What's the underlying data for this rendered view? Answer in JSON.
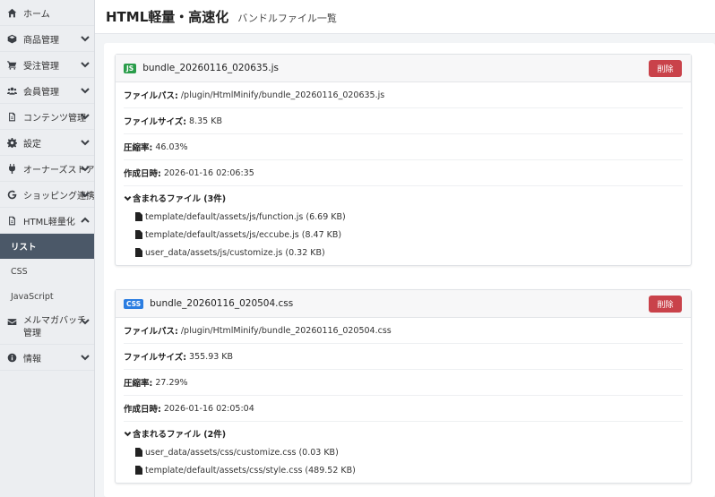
{
  "header": {
    "title": "HTML軽量・高速化",
    "subtitle": "バンドルファイル一覧"
  },
  "sidebar": {
    "items": [
      {
        "label": "ホーム",
        "icon": "home-icon"
      },
      {
        "label": "商品管理",
        "icon": "cube-icon"
      },
      {
        "label": "受注管理",
        "icon": "cart-icon"
      },
      {
        "label": "会員管理",
        "icon": "users-icon"
      },
      {
        "label": "コンテンツ管理",
        "icon": "file-icon"
      },
      {
        "label": "設定",
        "icon": "gear-icon"
      },
      {
        "label": "オーナーズストア",
        "icon": "plug-icon"
      },
      {
        "label": "ショッピング連携",
        "icon": "google-icon"
      },
      {
        "label": "HTML軽量化",
        "icon": "file-code-icon"
      },
      {
        "label": "メルマガバッチ管理",
        "icon": "envelope-icon"
      },
      {
        "label": "情報",
        "icon": "info-icon"
      }
    ],
    "html_submenu": [
      {
        "label": "リスト",
        "active": true
      },
      {
        "label": "CSS",
        "active": false
      },
      {
        "label": "JavaScript",
        "active": false
      }
    ]
  },
  "labels": {
    "path": "ファイルパス:",
    "size": "ファイルサイズ:",
    "ratio": "圧縮率:",
    "created": "作成日時:",
    "delete": "削除"
  },
  "bundles": [
    {
      "type": "JS",
      "name": "bundle_20260116_020635.js",
      "path": "/plugin/HtmlMinify/bundle_20260116_020635.js",
      "size": "8.35 KB",
      "ratio": "46.03%",
      "created": "2026-01-16 02:06:35",
      "files_label": "含まれるファイル (3件)",
      "files": [
        "template/default/assets/js/function.js (6.69 KB)",
        "template/default/assets/js/eccube.js (8.47 KB)",
        "user_data/assets/js/customize.js (0.32 KB)"
      ]
    },
    {
      "type": "CSS",
      "name": "bundle_20260116_020504.css",
      "path": "/plugin/HtmlMinify/bundle_20260116_020504.css",
      "size": "355.93 KB",
      "ratio": "27.29%",
      "created": "2026-01-16 02:05:04",
      "files_label": "含まれるファイル (2件)",
      "files": [
        "user_data/assets/css/customize.css (0.03 KB)",
        "template/default/assets/css/style.css (489.52 KB)"
      ]
    }
  ],
  "colors": {
    "sidebar_active": "#4b5868",
    "delete_button": "#c9424a",
    "js_badge": "#2a9d4a",
    "css_badge": "#2b7de1"
  }
}
